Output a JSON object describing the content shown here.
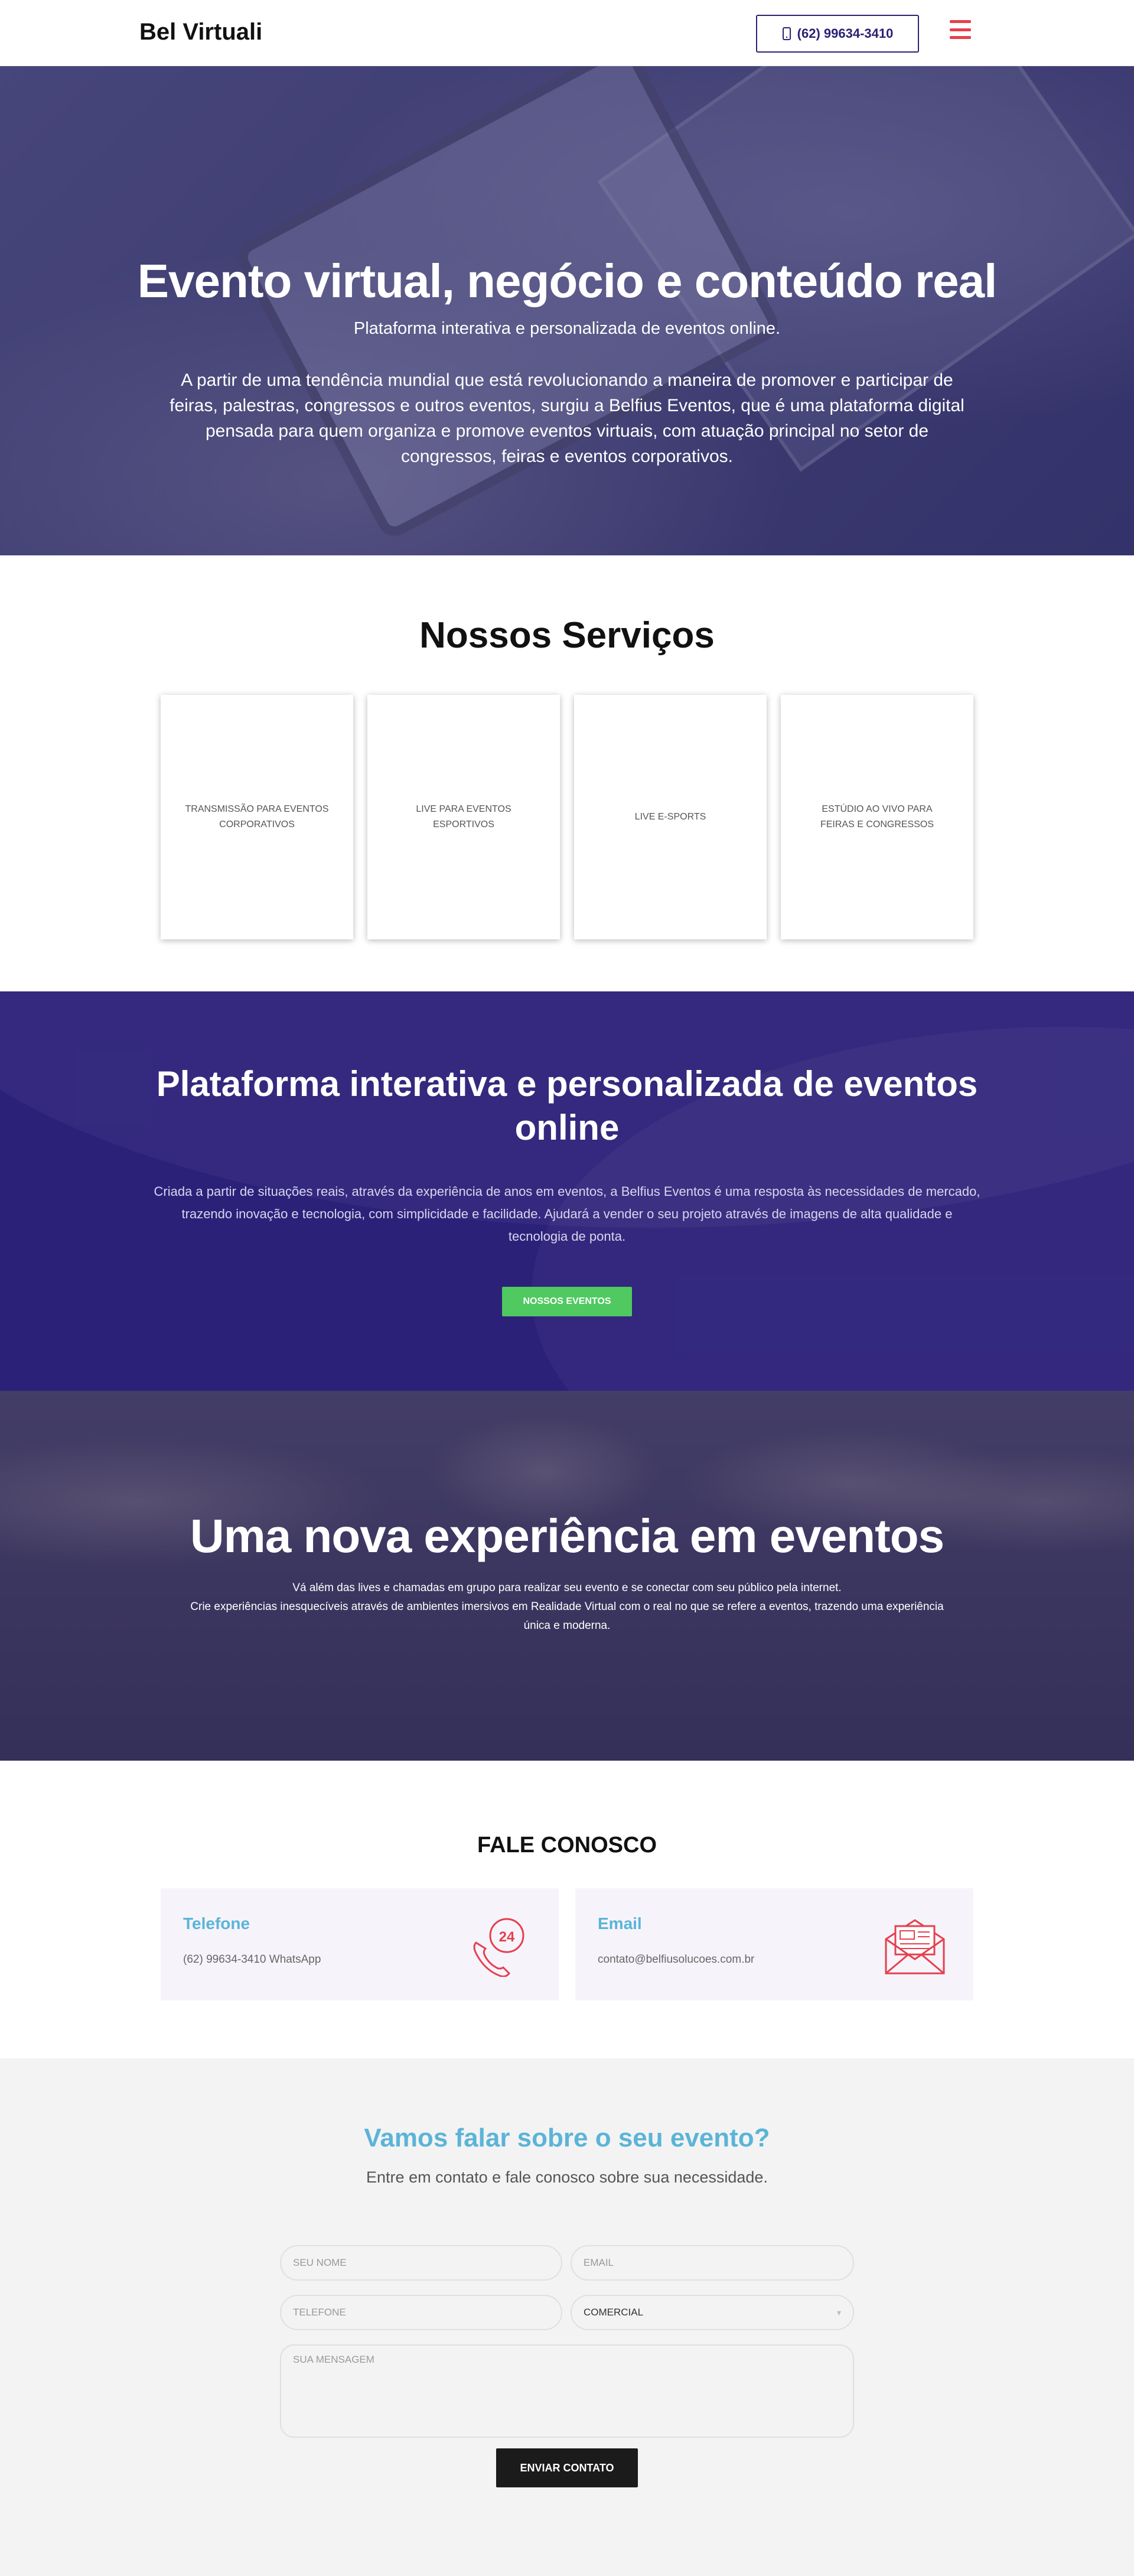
{
  "header": {
    "logo": "Bel Virtuali",
    "phone": "(62) 99634-3410"
  },
  "hero": {
    "title": "Evento virtual, negócio e conteúdo real",
    "subtitle": "Plataforma interativa e personalizada de eventos online.",
    "paragraph": "A partir de uma tendência mundial que está revolucionando a maneira de promover e participar de feiras, palestras, congressos e outros eventos, surgiu a Belfius Eventos, que é uma plataforma digital pensada para quem organiza e promove eventos virtuais, com atuação principal no setor de congressos, feiras e eventos corporativos."
  },
  "services": {
    "title": "Nossos Serviços",
    "items": [
      {
        "label": "Transmissão para eventos corporativos"
      },
      {
        "label": "Live para eventos esportivos"
      },
      {
        "label": "Live e-sports"
      },
      {
        "label": "Estúdio ao vivo para feiras e congressos"
      }
    ]
  },
  "platform": {
    "title": "Plataforma interativa e personalizada de eventos online",
    "text": "Criada a partir de situações reais, através da experiência de anos em eventos, a Belfius Eventos é uma resposta às necessidades de mercado, trazendo inovação e tecnologia, com simplicidade e facilidade. Ajudará a vender o seu projeto através de imagens de alta qualidade e tecnologia de ponta.",
    "button": "NOSSOS EVENTOS"
  },
  "experience": {
    "title": "Uma nova experiência em eventos",
    "line1": "Vá além das lives e chamadas em grupo para realizar seu evento e se conectar com seu público pela internet.",
    "line2": "Crie experiências inesquecíveis através de ambientes imersivos em Realidade Virtual com o real no que se refere a eventos, trazendo uma experiência única e moderna."
  },
  "contact": {
    "title": "FALE CONOSCO",
    "phone_card": {
      "title": "Telefone",
      "value": "(62) 99634-3410 WhatsApp",
      "icon": "phone-24h-icon"
    },
    "email_card": {
      "title": "Email",
      "value": "contato@belfiusolucoes.com.br",
      "icon": "newsletter-envelope-icon"
    }
  },
  "form": {
    "title": "Vamos falar sobre o seu evento?",
    "subtitle": "Entre em contato e fale conosco sobre sua necessidade.",
    "name_placeholder": "SEU NOME",
    "email_placeholder": "EMAIL",
    "phone_placeholder": "TELEFONE",
    "select_value": "COMERCIAL",
    "message_placeholder": "SUA MENSAGEM",
    "submit": "ENVIAR CONTATO"
  },
  "colors": {
    "accent_red": "#e5404f",
    "brand_purple": "#2b2274",
    "accent_green": "#4fc960",
    "accent_blue": "#5bb4d8"
  }
}
